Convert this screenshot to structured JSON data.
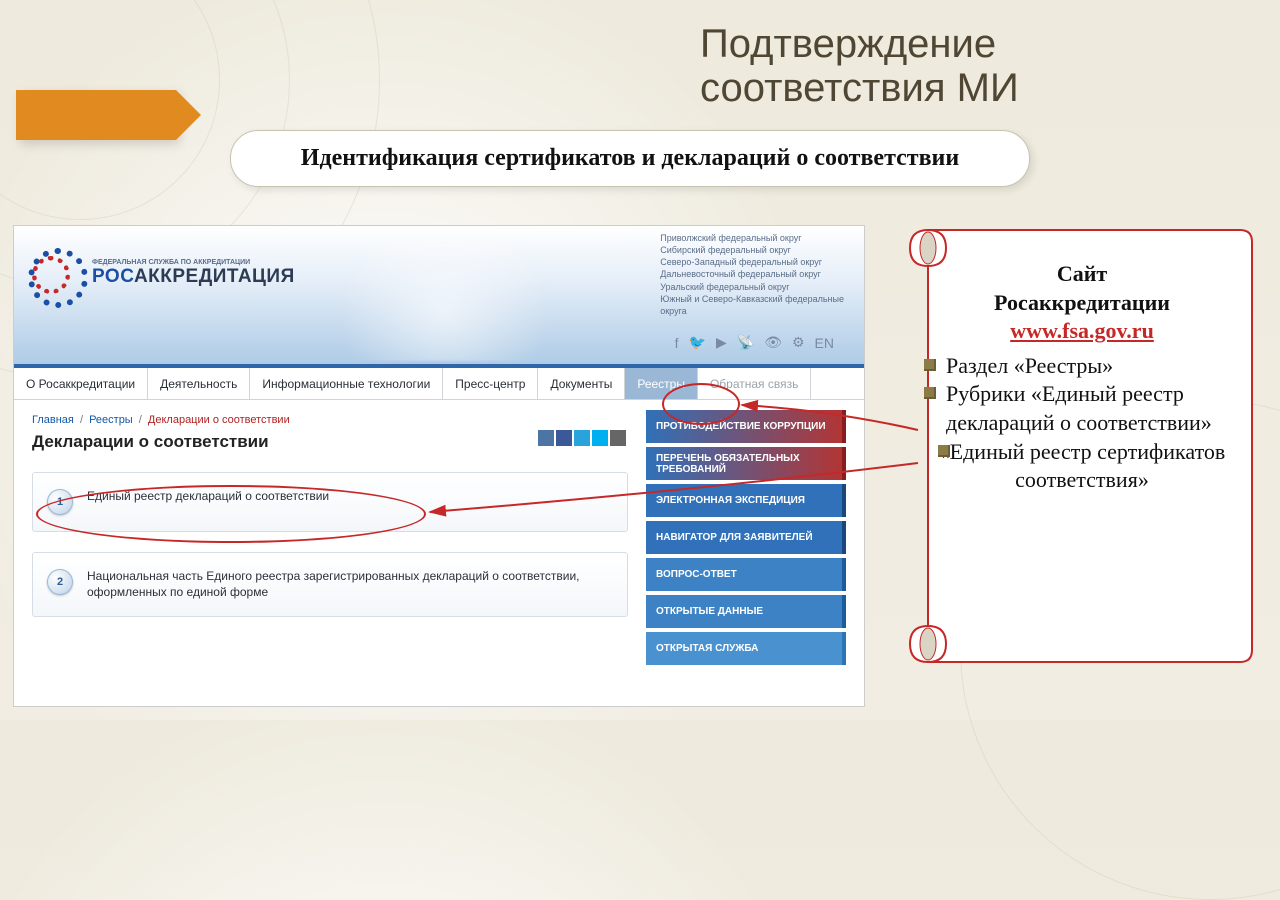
{
  "slide": {
    "title_line1": "Подтверждение",
    "title_line2": "соответствия МИ",
    "subtitle": "Идентификация сертификатов и деклараций о соответствии"
  },
  "site": {
    "logo": {
      "small_text": "ФЕДЕРАЛЬНАЯ СЛУЖБА ПО АККРЕДИТАЦИИ",
      "prefix": "РОС",
      "suffix": "АККРЕДИТАЦИЯ"
    },
    "districts": [
      "Приволжский федеральный округ",
      "Сибирский федеральный округ",
      "Северо-Западный федеральный округ",
      "Дальневосточный федеральный округ",
      "Уральский федеральный округ",
      "Южный и Северо-Кавказский федеральные",
      "округа"
    ],
    "lang": "EN",
    "nav": [
      "О Росаккредитации",
      "Деятельность",
      "Информационные технологии",
      "Пресс-центр",
      "Документы",
      "Реестры",
      "Обратная связь"
    ],
    "breadcrumb": {
      "home": "Главная",
      "section": "Реестры",
      "current": "Декларации о соответствии"
    },
    "page_title": "Декларации о соответствии",
    "entries": [
      {
        "num": "1",
        "text": "Единый реестр деклараций о соответствии"
      },
      {
        "num": "2",
        "text": "Национальная часть Единого реестра зарегистрированных деклараций о соответствии, оформленных по единой форме"
      }
    ],
    "right_buttons": [
      "ПРОТИВОДЕЙСТВИЕ КОРРУПЦИИ",
      "ПЕРЕЧЕНЬ ОБЯЗАТЕЛЬНЫХ ТРЕБОВАНИЙ",
      "ЭЛЕКТРОННАЯ ЭКСПЕДИЦИЯ",
      "НАВИГАТОР ДЛЯ ЗАЯВИТЕЛЕЙ",
      "ВОПРОС-ОТВЕТ",
      "ОТКРЫТЫЕ ДАННЫЕ",
      "ОТКРЫТАЯ СЛУЖБА"
    ]
  },
  "note": {
    "line1": "Сайт",
    "line2": "Росаккредитации",
    "url": "www.fsa.gov.ru",
    "bullets": [
      "Раздел «Реестры»",
      "Рубрики «Единый реестр деклараций о соответствии»",
      "«Единый реестр сертификатов соответствия»"
    ]
  }
}
